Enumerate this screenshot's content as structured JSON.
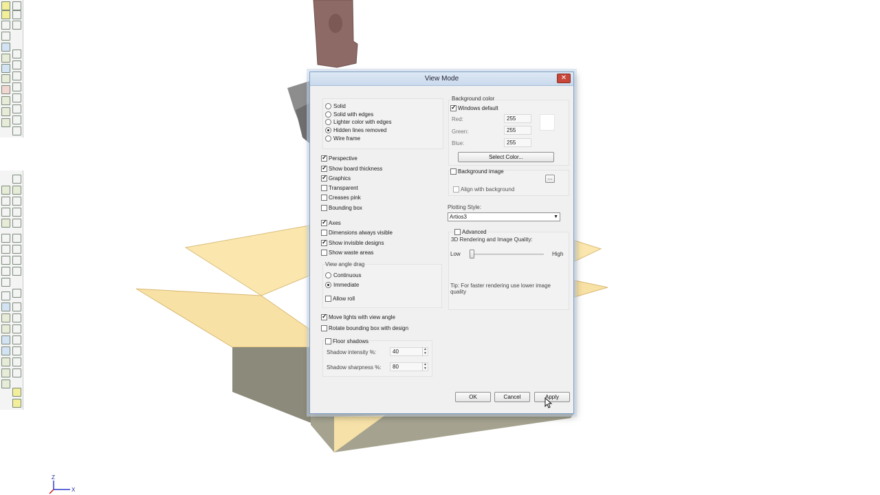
{
  "axes": {
    "z": "Z",
    "x": "X"
  },
  "dialog": {
    "title": "View Mode",
    "close": "✕",
    "render_modes": [
      {
        "label": "Solid",
        "selected": false
      },
      {
        "label": "Solid with edges",
        "selected": false
      },
      {
        "label": "Lighter color with edges",
        "selected": false
      },
      {
        "label": "Hidden lines removed",
        "selected": true
      },
      {
        "label": "Wire frame",
        "selected": false
      }
    ],
    "display_options": [
      {
        "label": "Perspective",
        "checked": true
      },
      {
        "label": "Show board thickness",
        "checked": true
      },
      {
        "label": "Graphics",
        "checked": true
      },
      {
        "label": "Transparent",
        "checked": false
      },
      {
        "label": "Creases pink",
        "checked": false
      },
      {
        "label": "Bounding box",
        "checked": false
      }
    ],
    "display_options2": [
      {
        "label": "Axes",
        "checked": true
      },
      {
        "label": "Dimensions always visible",
        "checked": false
      },
      {
        "label": "Show invisible designs",
        "checked": true
      },
      {
        "label": "Show waste areas",
        "checked": false
      }
    ],
    "view_angle_drag": {
      "label": "View angle drag",
      "options": [
        {
          "label": "Continuous",
          "selected": false
        },
        {
          "label": "Immediate",
          "selected": true
        }
      ],
      "allow_roll": {
        "label": "Allow roll",
        "checked": false
      }
    },
    "lights": {
      "label": "Move lights with view angle",
      "checked": true
    },
    "rotate_bbox": {
      "label": "Rotate bounding box with design",
      "checked": false
    },
    "floor_shadows": {
      "label": "Floor shadows",
      "checked": false,
      "intensity_label": "Shadow intensity %:",
      "intensity": "40",
      "sharpness_label": "Shadow sharpness %:",
      "sharpness": "80"
    },
    "background_color": {
      "label": "Background color",
      "windows_default": {
        "label": "Windows default",
        "checked": true
      },
      "red_label": "Red:",
      "red": "255",
      "green_label": "Green:",
      "green": "255",
      "blue_label": "Blue:",
      "blue": "255",
      "swatch": "#ffffff",
      "select_color": "Select Color..."
    },
    "background_image": {
      "label": "Background image",
      "checked": false,
      "browse": "...",
      "align": {
        "label": "Align with background",
        "checked": false
      }
    },
    "plotting_style": {
      "label": "Plotting Style:",
      "value": "Artios3"
    },
    "advanced": {
      "label": "Advanced",
      "checked": false
    },
    "quality": {
      "label": "3D Rendering and Image Quality:",
      "low": "Low",
      "high": "High",
      "level": 0.0
    },
    "tip": "Tip: For faster rendering use lower image quality",
    "buttons": {
      "ok": "OK",
      "cancel": "Cancel",
      "apply": "Apply"
    }
  }
}
